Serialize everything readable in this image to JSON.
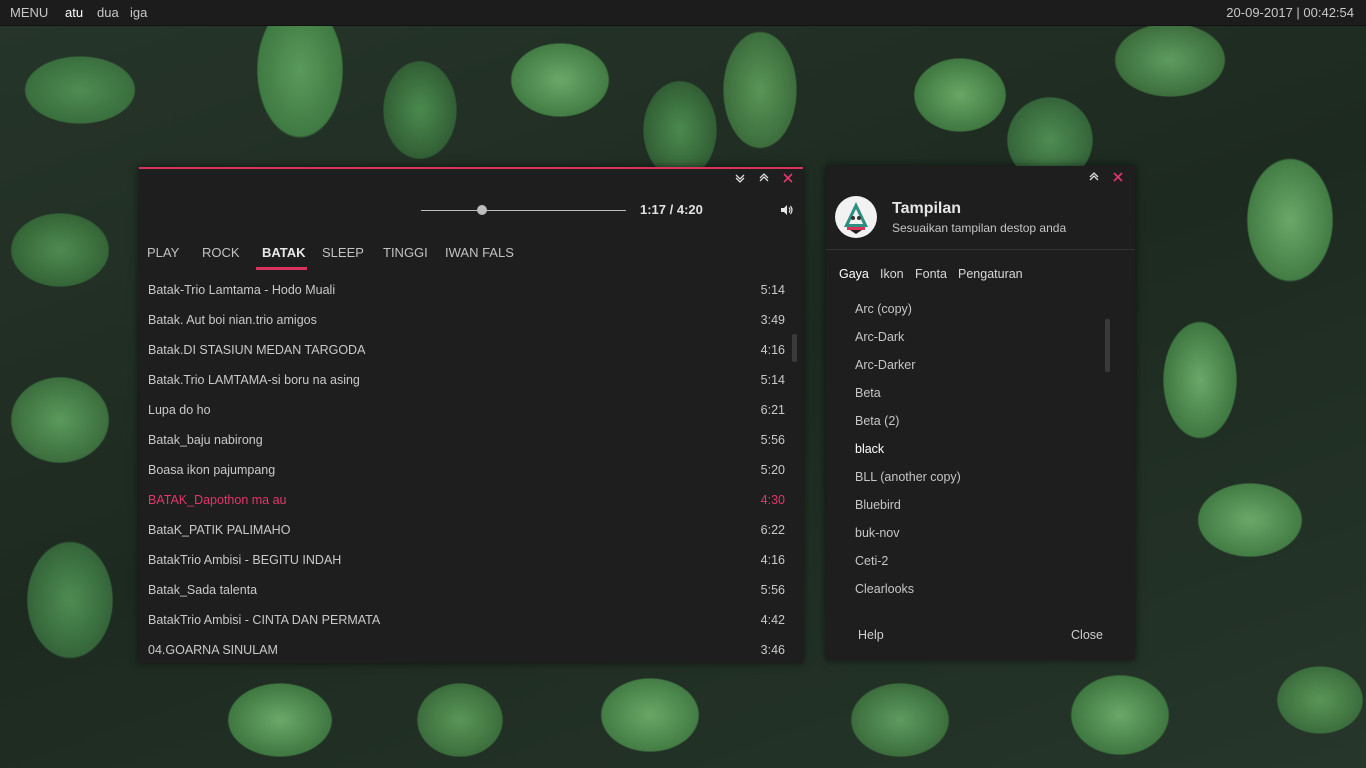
{
  "panel": {
    "menu": "MENU",
    "workspaces": [
      "atu",
      "dua",
      "iga"
    ],
    "active_workspace": "atu",
    "clock": "20-09-2017  |  00:42:54"
  },
  "player": {
    "time": "1:17 / 4:20",
    "progress": 0.296,
    "tabs": [
      "PLAY",
      "ROCK",
      "BATAK",
      "SLEEP",
      "TINGGI",
      "IWAN FALS"
    ],
    "active_tab": "BATAK",
    "tracks": [
      {
        "title": "Batak-Trio Lamtama - Hodo Muali",
        "duration": "5:14"
      },
      {
        "title": "Batak. Aut boi nian.trio amigos",
        "duration": "3:49"
      },
      {
        "title": "Batak.DI STASIUN MEDAN TARGODA",
        "duration": "4:16"
      },
      {
        "title": "Batak.Trio LAMTAMA-si boru na asing",
        "duration": "5:14"
      },
      {
        "title": "Lupa do ho",
        "duration": "6:21"
      },
      {
        "title": "Batak_baju nabirong",
        "duration": "5:56"
      },
      {
        "title": "Boasa ikon pajumpang",
        "duration": "5:20"
      },
      {
        "title": "BATAK_Dapothon ma au",
        "duration": "4:30"
      },
      {
        "title": "BataK_PATIK PALIMAHO",
        "duration": "6:22"
      },
      {
        "title": "BatakTrio Ambisi  - BEGITU INDAH",
        "duration": "4:16"
      },
      {
        "title": "Batak_Sada talenta",
        "duration": "5:56"
      },
      {
        "title": "BatakTrio Ambisi  - CINTA DAN PERMATA",
        "duration": "4:42"
      },
      {
        "title": "04.GOARNA SINULAM",
        "duration": "3:46"
      }
    ],
    "playing_index": 7,
    "accent": "#d9345c"
  },
  "appearance": {
    "title": "Tampilan",
    "subtitle": "Sesuaikan tampilan destop anda",
    "tabs": [
      "Gaya",
      "Ikon",
      "Fonta",
      "Pengaturan"
    ],
    "active_tab": "Gaya",
    "themes": [
      "Arc (copy)",
      "Arc-Dark",
      "Arc-Darker",
      "Beta",
      "Beta (2)",
      "black",
      "BLL (another copy)",
      "Bluebird",
      "buk-nov",
      "Ceti-2",
      "Clearlooks"
    ],
    "selected_theme": "black",
    "help_label": "Help",
    "close_label": "Close"
  }
}
